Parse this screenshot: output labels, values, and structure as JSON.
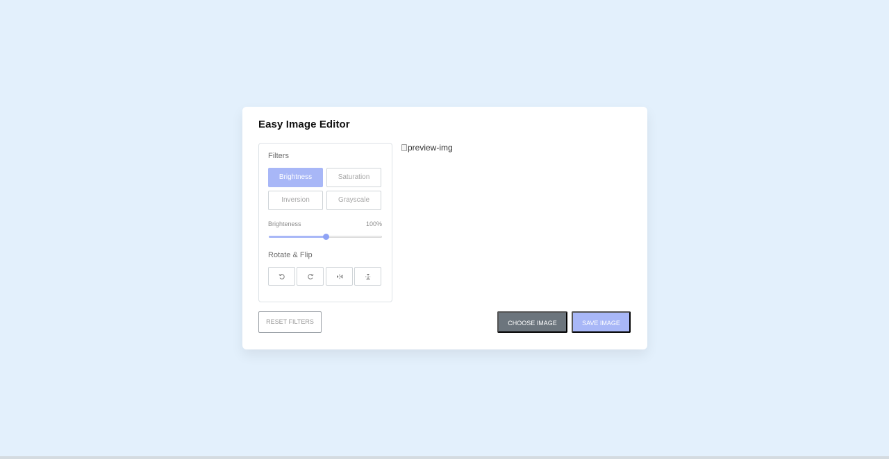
{
  "editor": {
    "title": "Easy Image Editor",
    "filters_label": "Filters",
    "filters": [
      {
        "label": "Brightness",
        "active": true
      },
      {
        "label": "Saturation",
        "active": false
      },
      {
        "label": "Inversion",
        "active": false
      },
      {
        "label": "Grayscale",
        "active": false
      }
    ],
    "slider": {
      "name": "Brighteness",
      "value_text": "100%",
      "fraction": 0.5
    },
    "rotate_label": "Rotate & Flip",
    "rotate_buttons": [
      {
        "icon": "rotate-left-icon"
      },
      {
        "icon": "rotate-right-icon"
      },
      {
        "icon": "flip-horizontal-icon"
      },
      {
        "icon": "flip-vertical-icon"
      }
    ],
    "preview_alt": "preview-img",
    "reset_label": "RESET FILTERS",
    "choose_label": "CHOOSE IMAGE",
    "save_label": "SAVE IMAGE"
  },
  "colors": {
    "background": "#e3f0fc",
    "accent": "#a8b7f7",
    "choose_button": "#6c757d"
  }
}
